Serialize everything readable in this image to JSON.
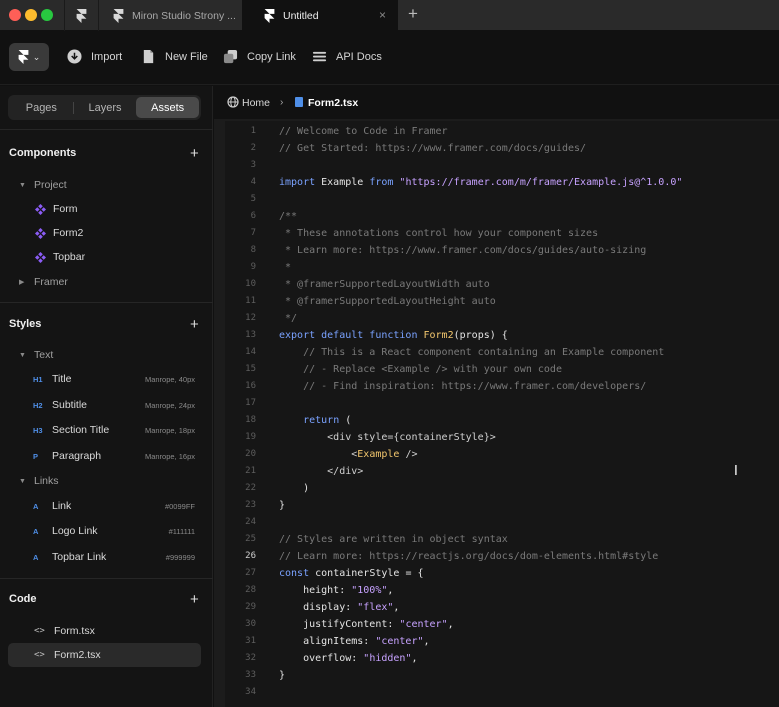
{
  "tabs": [
    {
      "label": ""
    },
    {
      "label": "Miron Studio Strony ..."
    },
    {
      "label": "Untitled"
    }
  ],
  "tab_close": "×",
  "tab_add": "+",
  "toolbar": {
    "menu_chevron": "⌄",
    "import_label": "Import",
    "new_file_label": "New File",
    "copy_link_label": "Copy Link",
    "api_docs_label": "API Docs"
  },
  "sidebar": {
    "segments": [
      "Pages",
      "Layers",
      "Assets"
    ],
    "active_segment": "Assets",
    "components": {
      "title": "Components",
      "plus": "+",
      "project_label": "Project",
      "items": [
        "Form",
        "Form2",
        "Topbar"
      ],
      "framer_label": "Framer"
    },
    "styles": {
      "title": "Styles",
      "plus": "+",
      "text_group": "Text",
      "text_items": [
        {
          "tag": "H1",
          "label": "Title",
          "meta": "Manrope, 40px"
        },
        {
          "tag": "H2",
          "label": "Subtitle",
          "meta": "Manrope, 24px"
        },
        {
          "tag": "H3",
          "label": "Section Title",
          "meta": "Manrope, 18px"
        },
        {
          "tag": "P",
          "label": "Paragraph",
          "meta": "Manrope, 16px"
        }
      ],
      "links_group": "Links",
      "link_items": [
        {
          "tag": "A",
          "label": "Link",
          "meta": "#0099FF"
        },
        {
          "tag": "A",
          "label": "Logo Link",
          "meta": "#111111"
        },
        {
          "tag": "A",
          "label": "Topbar Link",
          "meta": "#999999"
        }
      ]
    },
    "code": {
      "title": "Code",
      "plus": "+",
      "icon_glyph": "<>",
      "items": [
        "Form.tsx",
        "Form2.tsx"
      ],
      "active_item": "Form2.tsx"
    }
  },
  "breadcrumb": {
    "home": "Home",
    "separator": "›",
    "file": "Form2.tsx"
  },
  "editor": {
    "current_line": 26,
    "lines": [
      {
        "n": "1",
        "text": "// Welcome to Code in Framer",
        "kind": "comment"
      },
      {
        "n": "2",
        "text": "// Get Started: https://www.framer.com/docs/guides/",
        "kind": "comment"
      },
      {
        "n": "3",
        "text": "",
        "kind": "plain"
      },
      {
        "n": "4",
        "text": "",
        "kind": "import",
        "kw1": "import",
        "name": " Example ",
        "kw2": "from",
        "str": " \"https://framer.com/m/framer/Example.js@^1.0.0\""
      },
      {
        "n": "5",
        "text": "",
        "kind": "plain"
      },
      {
        "n": "6",
        "text": "/**",
        "kind": "comment"
      },
      {
        "n": "7",
        "text": " * These annotations control how your component sizes",
        "kind": "comment"
      },
      {
        "n": "8",
        "text": " * Learn more: https://www.framer.com/docs/guides/auto-sizing",
        "kind": "comment"
      },
      {
        "n": "9",
        "text": " *",
        "kind": "comment"
      },
      {
        "n": "10",
        "text": " * @framerSupportedLayoutWidth auto",
        "kind": "comment"
      },
      {
        "n": "11",
        "text": " * @framerSupportedLayoutHeight auto",
        "kind": "comment"
      },
      {
        "n": "12",
        "text": " */",
        "kind": "comment"
      },
      {
        "n": "13",
        "text": "",
        "kind": "function",
        "kw": "export default function ",
        "fn": "Form2",
        "rest": "(props) {"
      },
      {
        "n": "14",
        "text": "    // This is a React component containing an Example component",
        "kind": "comment"
      },
      {
        "n": "15",
        "text": "    // - Replace <Example /> with your own code",
        "kind": "comment"
      },
      {
        "n": "16",
        "text": "    // - Find inspiration: https://www.framer.com/developers/",
        "kind": "comment"
      },
      {
        "n": "17",
        "text": "",
        "kind": "plain"
      },
      {
        "n": "18",
        "text": "",
        "kind": "kwline",
        "indent": "    ",
        "kw": "return",
        "rest": " ("
      },
      {
        "n": "19",
        "text": "        <div style={containerStyle}>",
        "kind": "tag"
      },
      {
        "n": "20",
        "text": "",
        "kind": "comp",
        "indent": "            ",
        "open": "<",
        "name": "Example",
        "close": " />"
      },
      {
        "n": "21",
        "text": "        </div>",
        "kind": "tag"
      },
      {
        "n": "22",
        "text": "    )",
        "kind": "plain"
      },
      {
        "n": "23",
        "text": "}",
        "kind": "plain"
      },
      {
        "n": "24",
        "text": "",
        "kind": "plain"
      },
      {
        "n": "25",
        "text": "// Styles are written in object syntax",
        "kind": "comment"
      },
      {
        "n": "26",
        "text": "// Learn more: https://reactjs.org/docs/dom-elements.html#style",
        "kind": "comment"
      },
      {
        "n": "27",
        "text": "",
        "kind": "const",
        "kw": "const",
        "rest": " containerStyle = {"
      },
      {
        "n": "28",
        "text": "",
        "kind": "prop",
        "key": "    height: ",
        "str": "\"100%\"",
        "tail": ","
      },
      {
        "n": "29",
        "text": "",
        "kind": "prop",
        "key": "    display: ",
        "str": "\"flex\"",
        "tail": ","
      },
      {
        "n": "30",
        "text": "",
        "kind": "prop",
        "key": "    justifyContent: ",
        "str": "\"center\"",
        "tail": ","
      },
      {
        "n": "31",
        "text": "",
        "kind": "prop",
        "key": "    alignItems: ",
        "str": "\"center\"",
        "tail": ","
      },
      {
        "n": "32",
        "text": "",
        "kind": "prop",
        "key": "    overflow: ",
        "str": "\"hidden\"",
        "tail": ","
      },
      {
        "n": "33",
        "text": "}",
        "kind": "plain"
      },
      {
        "n": "34",
        "text": "",
        "kind": "plain"
      }
    ]
  },
  "colors": {
    "accent_blue": "#4f8fe8",
    "component_purple": "#8b5cf6",
    "keyword": "#7aa2ff",
    "string": "#c7a2ff",
    "function": "#f2c66d",
    "comment": "#7a7a7a"
  }
}
